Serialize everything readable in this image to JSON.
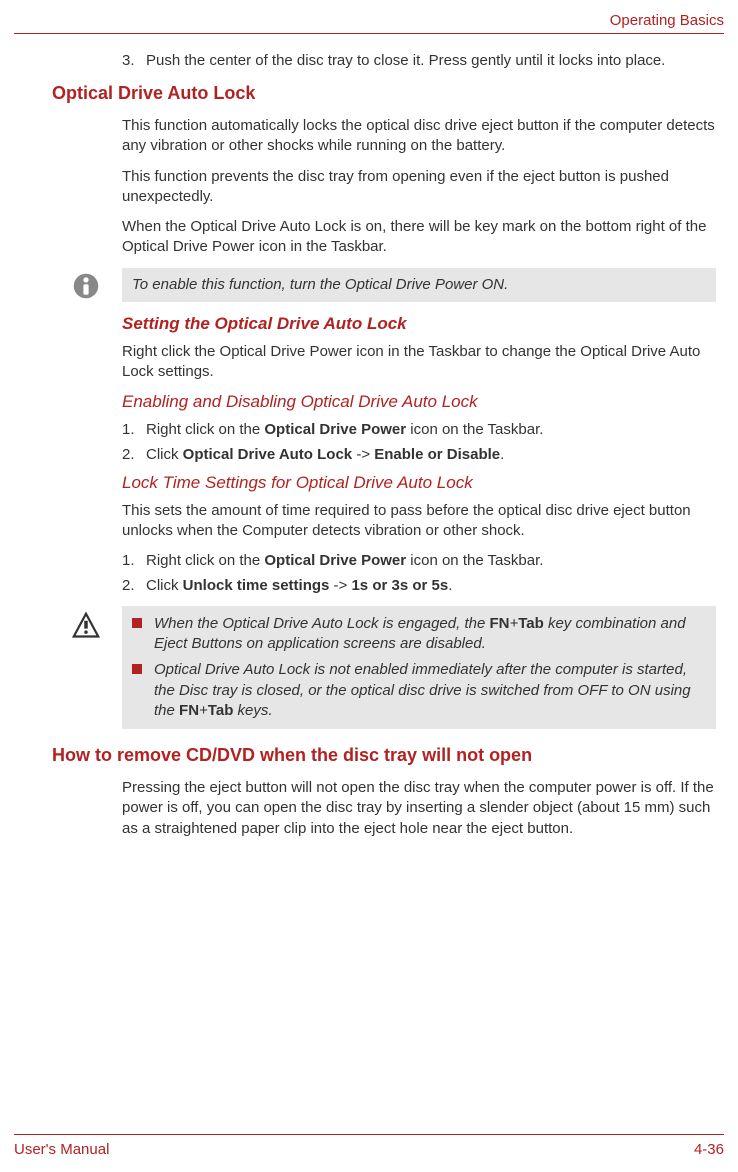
{
  "header": {
    "section": "Operating Basics"
  },
  "step3": {
    "num": "3.",
    "text": "Push the center of the disc tray to close it. Press gently until it locks into place."
  },
  "section1": {
    "title": "Optical Drive Auto Lock",
    "p1": "This function automatically locks the optical disc drive eject button if the computer detects any vibration or other shocks while running on the battery.",
    "p2": "This function prevents the disc tray from opening even if the eject button is pushed unexpectedly.",
    "p3": "When the Optical Drive Auto Lock is on, there will be key mark on the bottom right of the Optical Drive Power icon in the Taskbar."
  },
  "note1": {
    "text": "To enable this function, turn the Optical Drive Power ON."
  },
  "subsection1": {
    "title": "Setting the Optical Drive Auto Lock",
    "p1": "Right click the Optical Drive Power icon in the Taskbar to change the Optical Drive Auto Lock settings."
  },
  "subsection2": {
    "title": "Enabling and Disabling Optical Drive Auto Lock",
    "step1_num": "1.",
    "step1_a": "Right click on the ",
    "step1_b": "Optical Drive Power",
    "step1_c": " icon on the Taskbar.",
    "step2_num": "2.",
    "step2_a": "Click ",
    "step2_b": "Optical Drive Auto Lock",
    "step2_c": " -> ",
    "step2_d": "Enable or Disable",
    "step2_e": "."
  },
  "subsection3": {
    "title": "Lock Time Settings for Optical Drive Auto Lock",
    "p1": "This sets the amount of time required to pass before the optical disc drive eject button unlocks when the Computer detects vibration or other shock.",
    "step1_num": "1.",
    "step1_a": "Right click on the ",
    "step1_b": "Optical Drive Power",
    "step1_c": " icon on the Taskbar.",
    "step2_num": "2.",
    "step2_a": "Click ",
    "step2_b": "Unlock time settings",
    "step2_c": " -> ",
    "step2_d": "1s or 3s or 5s",
    "step2_e": "."
  },
  "caution1": {
    "b1_a": "When the Optical Drive Auto Lock is engaged, the ",
    "b1_b": "FN",
    "b1_c": "+",
    "b1_d": "Tab",
    "b1_e": " key combination and Eject Buttons on application screens are disabled.",
    "b2_a": "Optical Drive Auto Lock is not enabled immediately after the computer is started, the Disc tray is closed, or the optical disc drive is switched from OFF to ON using the ",
    "b2_b": "FN",
    "b2_c": "+",
    "b2_d": "Tab",
    "b2_e": " keys."
  },
  "section2": {
    "title": "How to remove CD/DVD when the disc tray will not open",
    "p1": "Pressing the eject button will not open the disc tray when the computer power is off. If the power is off, you can open the disc tray by inserting a slender object (about 15 mm) such as a straightened paper clip into the eject hole near the eject button."
  },
  "footer": {
    "left": "User's Manual",
    "right": "4-36"
  }
}
